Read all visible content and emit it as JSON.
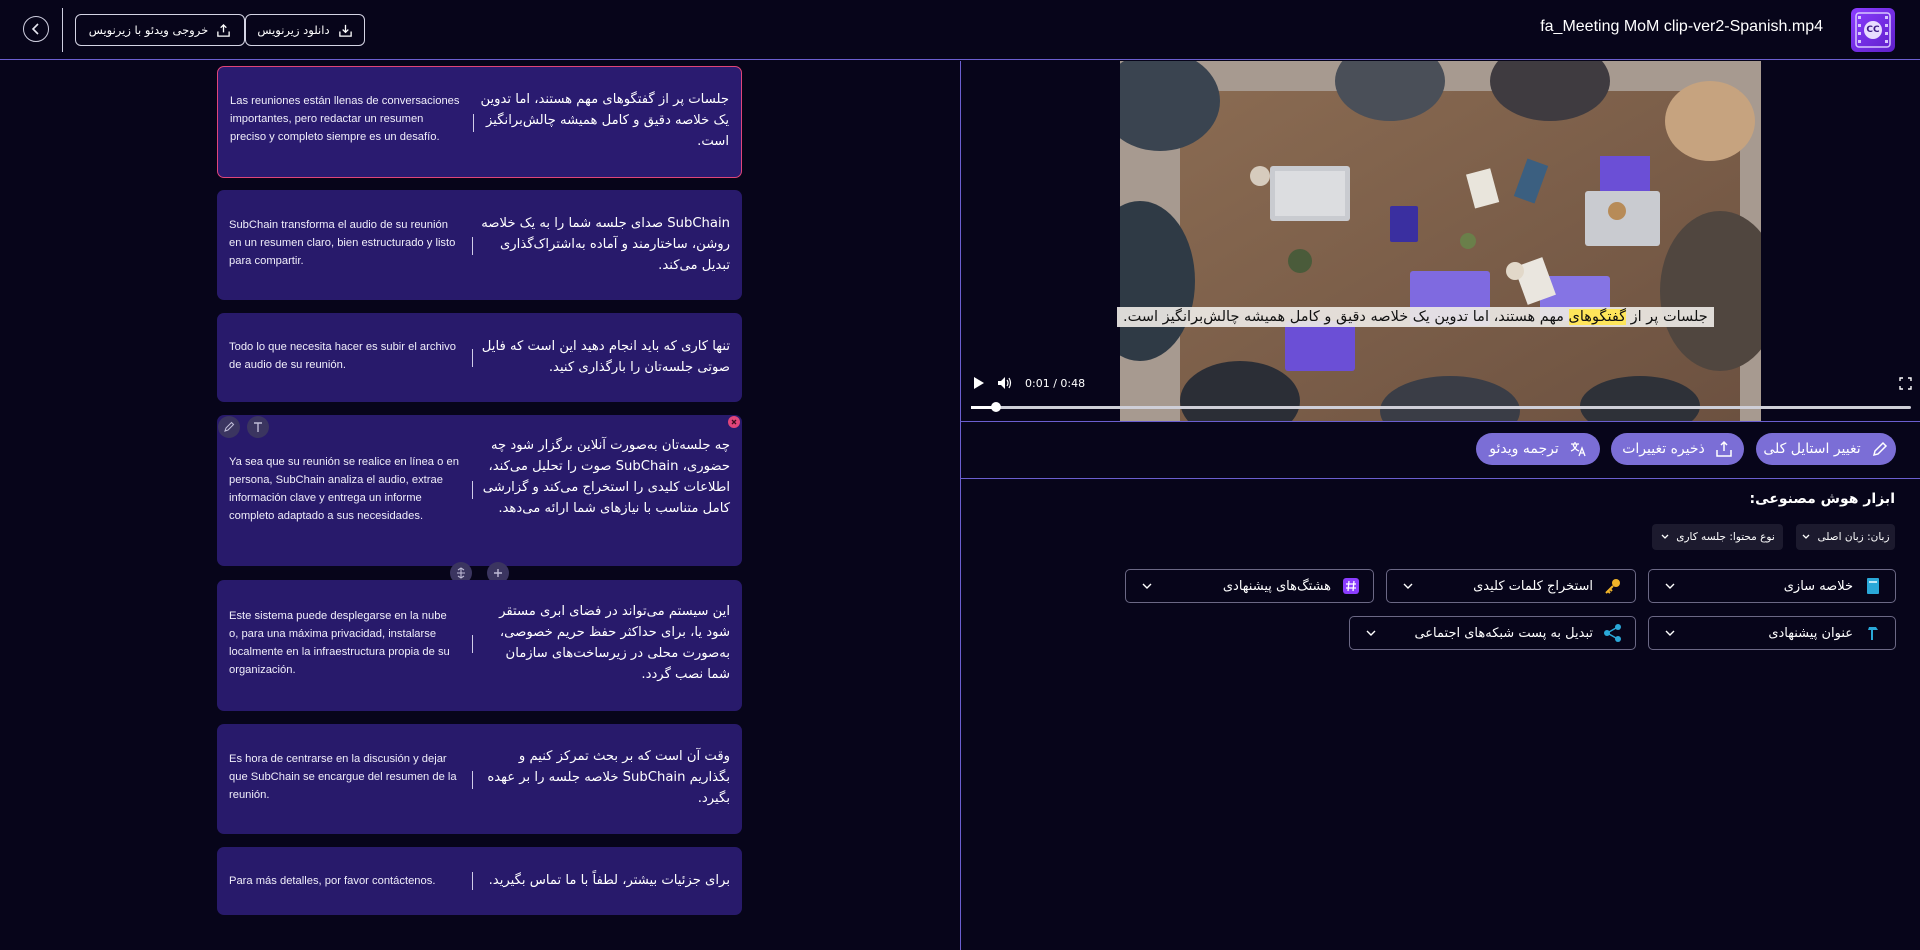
{
  "header": {
    "back_label": "<",
    "download_subtitles": "دانلود زیرنویس",
    "export_video": "خروجی ویدئو با زیرنویس",
    "file_name": "fa_Meeting MoM clip-ver2-Spanish.mp4",
    "logo_text": "CC"
  },
  "segments": [
    {
      "es": "Las reuniones están llenas de conversaciones importantes, pero redactar un resumen preciso y completo siempre es un desafío.",
      "fa": "جلسات پر از گفتگوهای مهم هستند، اما تدوین یک خلاصه دقیق و کامل همیشه چالش‌برانگیز است."
    },
    {
      "es": "SubChain transforma el audio de su reunión en un resumen claro, bien estructurado y listo para compartir.",
      "fa": "SubChain صدای جلسه شما را به یک خلاصه روشن، ساختارمند و آماده به‌اشتراک‌گذاری تبدیل می‌کند."
    },
    {
      "es": "Todo lo que necesita hacer es subir el archivo de audio de su reunión.",
      "fa": "تنها کاری که باید انجام دهید این است که فایل صوتی جلسه‌تان را بارگذاری کنید."
    },
    {
      "es": "Ya sea que su reunión se realice en línea o en persona, SubChain analiza el audio, extrae información clave y entrega un informe completo adaptado a sus necesidades.",
      "fa": "چه جلسه‌تان به‌صورت آنلاین برگزار شود چه حضوری، SubChain صوت را تحلیل می‌کند، اطلاعات کلیدی را استخراج می‌کند و گزارشی کامل متناسب با نیازهای شما ارائه می‌دهد."
    },
    {
      "es": "Este sistema puede desplegarse en la nube o, para una máxima privacidad, instalarse localmente en la infraestructura propia de su organización.",
      "fa": "این سیستم می‌تواند در فضای ابری مستقر شود یا، برای حداکثر حفظ حریم خصوصی، به‌صورت محلی در زیرساخت‌های سازمان شما نصب گردد."
    },
    {
      "es": "Es hora de centrarse en la discusión y dejar que SubChain se encargue del resumen de la reunión.",
      "fa": "وقت آن است که بر بحث تمرکز کنیم و بگذاریم SubChain خلاصه جلسه را بر عهده بگیرد."
    },
    {
      "es": "Para más detalles, por favor contáctenos.",
      "fa": "برای جزئیات بیشتر، لطفاً با ما تماس بگیرید."
    }
  ],
  "player": {
    "caption_before": "جلسات پر از ",
    "caption_highlight": "گفتگوهای",
    "caption_after": " مهم هستند، اما تدوین یک خلاصه دقیق و کامل همیشه چالش‌برانگیز است.",
    "time": "0:01 / 0:48",
    "progress": 0.027
  },
  "actions": {
    "change_style": "تغییر استایل کلی",
    "save_changes": "ذخیره تغییرات",
    "translate_video": "ترجمه ویدئو"
  },
  "ai_tools": {
    "title": "ابزار هوش مصنوعی:",
    "language_select": "زبان: زبان اصلی",
    "content_type_select": "نوع محتوا: جلسه کاری",
    "summarize": "خلاصه سازی",
    "extract_keywords": "استخراج کلمات کلیدی",
    "suggested_hashtags": "هشتگ‌های پیشنهادی",
    "suggested_title": "عنوان پیشنهادی",
    "social_post": "تبدیل به پست شبکه‌های اجتماعی"
  },
  "colors": {
    "accent": "#7b6ed6",
    "card": "#281a6b",
    "active_border": "#e0457a",
    "background": "#07051a"
  }
}
